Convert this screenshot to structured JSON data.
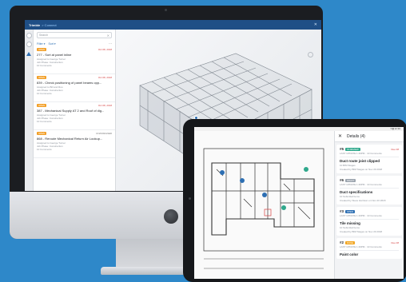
{
  "desktop_app": {
    "brand": "Trimble",
    "project": "> Connect",
    "search_placeholder": "Search",
    "filters": [
      "Filter ▾",
      "Sort ▾"
    ],
    "more": "···",
    "issues": [
      {
        "badge": "OPEN",
        "date": "Oct 08, 2018",
        "title": "277 - Sort at panel inline",
        "meta": [
          "Assigned to George Turner",
          "Job Phase: Construction",
          "10 Comments"
        ]
      },
      {
        "badge": "OPEN",
        "date": "Oct 08, 2018",
        "title": "839 - Check positioning of panel beams opp...",
        "meta": [
          "Assigned to Bill and Roo",
          "Job Phase: Construction",
          "10 Comments"
        ]
      },
      {
        "badge": "OPEN",
        "date": "Oct 08, 2018",
        "title": "387 - Mechanical Supply AT 2 and Roof of dig...",
        "meta": [
          "Assigned to George Turner",
          "Job Phase: Construction",
          "10 Comments"
        ]
      },
      {
        "badge": "OPEN",
        "date": "UNASSIGNED",
        "title": "868 - Reroute Mechanical Return Air Lookup...",
        "meta": [
          "Assigned to George Turner",
          "Job Phase: Construction",
          "10 Comments"
        ]
      }
    ]
  },
  "tablet_app": {
    "status_bar": "▾ ▮ 12:30",
    "details_title": "Details (4)",
    "cards": [
      {
        "num": "#5",
        "badge": "IN REVIEW",
        "badge_color": "#2fa88c",
        "due": "Due 08",
        "meta": "LAST UPDATE 1:40PM · 10 Comments",
        "title": "Duct route joist clipped",
        "lines": [
          "10 BIM Stages",
          "Created by BIM Stages on Nov 20 2018"
        ]
      },
      {
        "num": "#6",
        "badge": "DRAFT",
        "badge_color": "#9aa3ad",
        "due": "",
        "meta": "LAST UPDATE 1:40PM · 10 Comments",
        "title": "Duct specifications",
        "lines": [
          "10 Submittal Items",
          "Created by Steve Harrison on Nov 20 2018"
        ]
      },
      {
        "num": "#3",
        "badge": "OPEN",
        "badge_color": "#2d6fb3",
        "due": "",
        "meta": "LAST UPDATE 1:40PM · 10 Comments",
        "title": "Tile missing",
        "lines": [
          "10 Submittal Items",
          "Created by BIM Stages on Nov 20 2018"
        ]
      },
      {
        "num": "#2",
        "badge": "DONE",
        "badge_color": "#f2a51f",
        "due": "Due 08",
        "meta": "LAST UPDATE 1:40PM · 10 Comments",
        "title": "Paint color",
        "lines": []
      }
    ]
  },
  "colors": {
    "background": "#2e88c9",
    "header": "#1f4f86",
    "accent_orange": "#f2a51f"
  }
}
